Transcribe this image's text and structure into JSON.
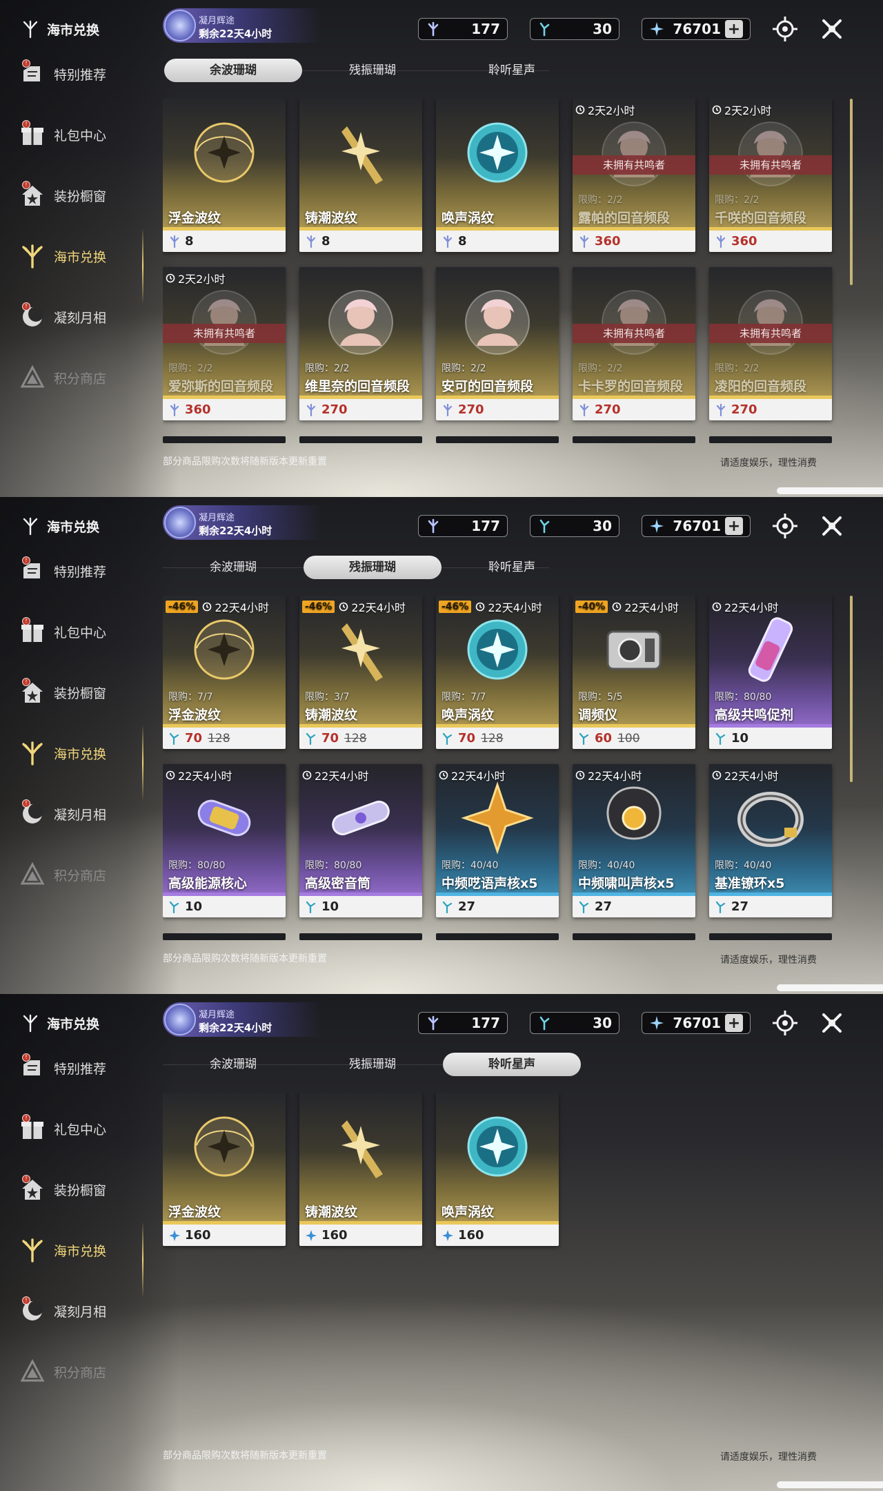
{
  "sidebar": {
    "title": "海市兑换",
    "items": [
      {
        "label": "特别推荐",
        "icon": "recommend-icon",
        "badge": "!"
      },
      {
        "label": "礼包中心",
        "icon": "gift-icon",
        "badge": "!"
      },
      {
        "label": "装扮橱窗",
        "icon": "wardrobe-icon",
        "badge": "!"
      },
      {
        "label": "海市兑换",
        "icon": "coral-icon",
        "badge": ""
      },
      {
        "label": "凝刻月相",
        "icon": "moon-icon",
        "badge": "!"
      },
      {
        "label": "积分商店",
        "icon": "points-icon",
        "badge": ""
      }
    ]
  },
  "header": {
    "event_title": "凝月辉途",
    "event_remaining": "剩余22天4小时",
    "currencies": [
      {
        "icon": "afterglow-coral-icon",
        "value": "177"
      },
      {
        "icon": "oscillated-coral-icon",
        "value": "30"
      },
      {
        "icon": "star-currency-icon",
        "value": "76701",
        "plus": "+"
      }
    ]
  },
  "tabs": [
    "余波珊瑚",
    "残振珊瑚",
    "聆听星声"
  ],
  "footer": {
    "note": "部分商品限购次数将随新版本更新重置",
    "tip": "请适度娱乐，理性消费"
  },
  "panels": [
    {
      "active_tab": 0,
      "cards": [
        {
          "name": "浮金波纹",
          "price": "8",
          "theme": "gold",
          "art": "floating-gold-orb-icon"
        },
        {
          "name": "铸潮波纹",
          "price": "8",
          "theme": "gold",
          "art": "tide-blade-icon"
        },
        {
          "name": "唤声涡纹",
          "price": "8",
          "theme": "gold",
          "art": "vortex-orb-icon"
        },
        {
          "name": "露帕的回音频段",
          "price": "360",
          "theme": "gold",
          "art": "character-portrait-icon",
          "timer": "2天2小时",
          "limit": "限购：2/2",
          "owned": "未拥有共鸣者",
          "price_red": true
        },
        {
          "name": "千咲的回音频段",
          "price": "360",
          "theme": "gold",
          "art": "character-portrait-icon",
          "timer": "2天2小时",
          "limit": "限购：2/2",
          "owned": "未拥有共鸣者",
          "price_red": true
        },
        {
          "name": "爱弥斯的回音频段",
          "price": "360",
          "theme": "gold",
          "art": "character-portrait-icon",
          "timer": "2天2小时",
          "limit": "限购：2/2",
          "owned": "未拥有共鸣者",
          "price_red": true
        },
        {
          "name": "维里奈的回音频段",
          "price": "270",
          "theme": "gold",
          "art": "character-portrait-icon",
          "limit": "限购：2/2",
          "price_red": true
        },
        {
          "name": "安可的回音频段",
          "price": "270",
          "theme": "gold",
          "art": "character-portrait-icon",
          "limit": "限购：2/2",
          "price_red": true
        },
        {
          "name": "卡卡罗的回音频段",
          "price": "270",
          "theme": "gold",
          "art": "character-portrait-icon",
          "limit": "限购：2/2",
          "owned": "未拥有共鸣者",
          "price_red": true
        },
        {
          "name": "凌阳的回音频段",
          "price": "270",
          "theme": "gold",
          "art": "character-portrait-icon",
          "limit": "限购：2/2",
          "owned": "未拥有共鸣者",
          "price_red": true
        }
      ]
    },
    {
      "active_tab": 1,
      "cards": [
        {
          "name": "浮金波纹",
          "price": "70",
          "old_price": "128",
          "discount": "-46%",
          "timer": "22天4小时",
          "limit": "限购：7/7",
          "theme": "gold",
          "art": "floating-gold-orb-icon",
          "price_red": true
        },
        {
          "name": "铸潮波纹",
          "price": "70",
          "old_price": "128",
          "discount": "-46%",
          "timer": "22天4小时",
          "limit": "限购：3/7",
          "theme": "gold",
          "art": "tide-blade-icon",
          "price_red": true
        },
        {
          "name": "唤声涡纹",
          "price": "70",
          "old_price": "128",
          "discount": "-46%",
          "timer": "22天4小时",
          "limit": "限购：7/7",
          "theme": "gold",
          "art": "vortex-orb-icon",
          "price_red": true
        },
        {
          "name": "调频仪",
          "price": "60",
          "old_price": "100",
          "discount": "-40%",
          "timer": "22天4小时",
          "limit": "限购：5/5",
          "theme": "gold",
          "art": "tuner-device-icon",
          "price_red": true
        },
        {
          "name": "高级共鸣促剂",
          "price": "10",
          "timer": "22天4小时",
          "limit": "限购：80/80",
          "theme": "purple",
          "art": "resonance-potion-icon"
        },
        {
          "name": "高级能源核心",
          "price": "10",
          "timer": "22天4小时",
          "limit": "限购：80/80",
          "theme": "purple",
          "art": "energy-core-icon"
        },
        {
          "name": "高级密音筒",
          "price": "10",
          "timer": "22天4小时",
          "limit": "限购：80/80",
          "theme": "purple",
          "art": "sealed-tube-icon"
        },
        {
          "name": "中频呓语声核x5",
          "price": "27",
          "timer": "22天4小时",
          "limit": "限购：40/40",
          "theme": "blue",
          "art": "whisper-core-icon"
        },
        {
          "name": "中频啸叫声核x5",
          "price": "27",
          "timer": "22天4小时",
          "limit": "限购：40/40",
          "theme": "blue",
          "art": "howl-core-icon"
        },
        {
          "name": "基准镣环x5",
          "price": "27",
          "timer": "22天4小时",
          "limit": "限购：40/40",
          "theme": "blue",
          "art": "ring-icon"
        }
      ]
    },
    {
      "active_tab": 2,
      "cards": [
        {
          "name": "浮金波纹",
          "price": "160",
          "theme": "gold",
          "art": "floating-gold-orb-icon"
        },
        {
          "name": "铸潮波纹",
          "price": "160",
          "theme": "gold",
          "art": "tide-blade-icon"
        },
        {
          "name": "唤声涡纹",
          "price": "160",
          "theme": "gold",
          "art": "vortex-orb-icon"
        }
      ]
    }
  ],
  "colors": {
    "accent_gold": "#f0d67a",
    "price_red": "#b5312b",
    "owned_banner": "#82323a",
    "discount": "#f0a522"
  }
}
